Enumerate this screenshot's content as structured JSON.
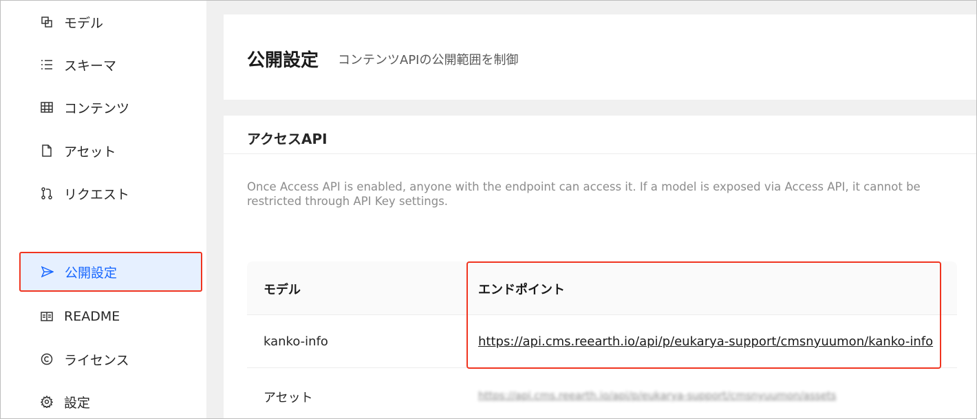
{
  "sidebar": {
    "items": [
      {
        "label": "モデル",
        "icon": "model-icon"
      },
      {
        "label": "スキーマ",
        "icon": "list-icon"
      },
      {
        "label": "コンテンツ",
        "icon": "table-icon"
      },
      {
        "label": "アセット",
        "icon": "file-icon"
      },
      {
        "label": "リクエスト",
        "icon": "pull-request-icon"
      },
      {
        "label": "公開設定",
        "icon": "send-icon",
        "active": true
      },
      {
        "label": "README",
        "icon": "book-icon"
      },
      {
        "label": "ライセンス",
        "icon": "copyright-icon"
      },
      {
        "label": "設定",
        "icon": "gear-icon"
      }
    ]
  },
  "header": {
    "title": "公開設定",
    "subtitle": "コンテンツAPIの公開範囲を制御"
  },
  "access_api": {
    "title": "アクセスAPI",
    "notice": "Once Access API is enabled, anyone with the endpoint can access it. If a model is exposed via Access API, it cannot be restricted through API Key settings.",
    "table": {
      "columns": [
        "モデル",
        "エンドポイント"
      ],
      "rows": [
        {
          "model": "kanko-info",
          "endpoint": "https://api.cms.reearth.io/api/p/eukarya-support/cmsnyuumon/kanko-info"
        },
        {
          "model": "アセット",
          "endpoint": "https://api.cms.reearth.io/api/p/eukarya-support/cmsnyuumon/assets"
        }
      ]
    }
  },
  "colors": {
    "accent": "#1766ff",
    "active_bg": "#e6f0ff",
    "highlight": "#f0341f"
  }
}
